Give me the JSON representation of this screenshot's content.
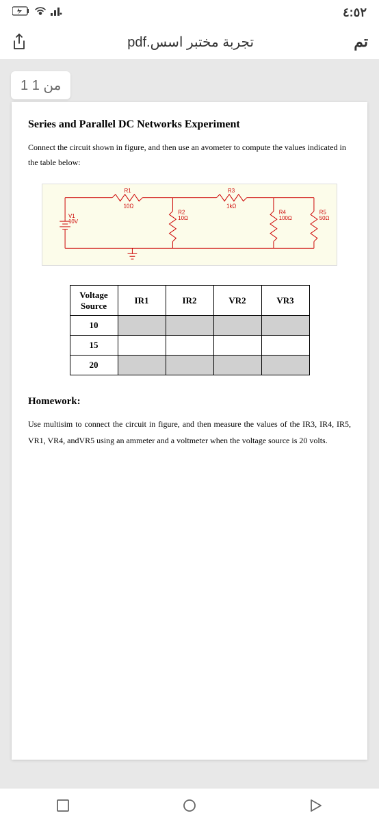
{
  "status": {
    "time": "٤:٥٢"
  },
  "nav": {
    "title": "تجربة مختبر اسس.pdf",
    "done": "تم"
  },
  "pageCounter": "1 من 1",
  "doc": {
    "title": "Series and Parallel DC Networks Experiment",
    "intro": "Connect the circuit shown in figure, and then use an avometer to compute the values indicated in the table below:",
    "circuit": {
      "v1": "V1",
      "v1val": "10V",
      "r1": "R1",
      "r1val": "10Ω",
      "r2": "R2",
      "r2val": "10Ω",
      "r3": "R3",
      "r3val": "1kΩ",
      "r4": "R4",
      "r4val": "100Ω",
      "r5": "R5",
      "r5val": "50Ω"
    },
    "table": {
      "h1a": "Voltage",
      "h1b": "Source",
      "h2": "IR1",
      "h3": "IR2",
      "h4": "VR2",
      "h5": "VR3",
      "rows": [
        "10",
        "15",
        "20"
      ]
    },
    "hw_heading": "Homework:",
    "hw_text": "Use multisim to connect the circuit in figure, and then measure the values of the IR3, IR4, IR5, VR1, VR4, andVR5 using an ammeter and a voltmeter when the voltage source is 20 volts."
  }
}
